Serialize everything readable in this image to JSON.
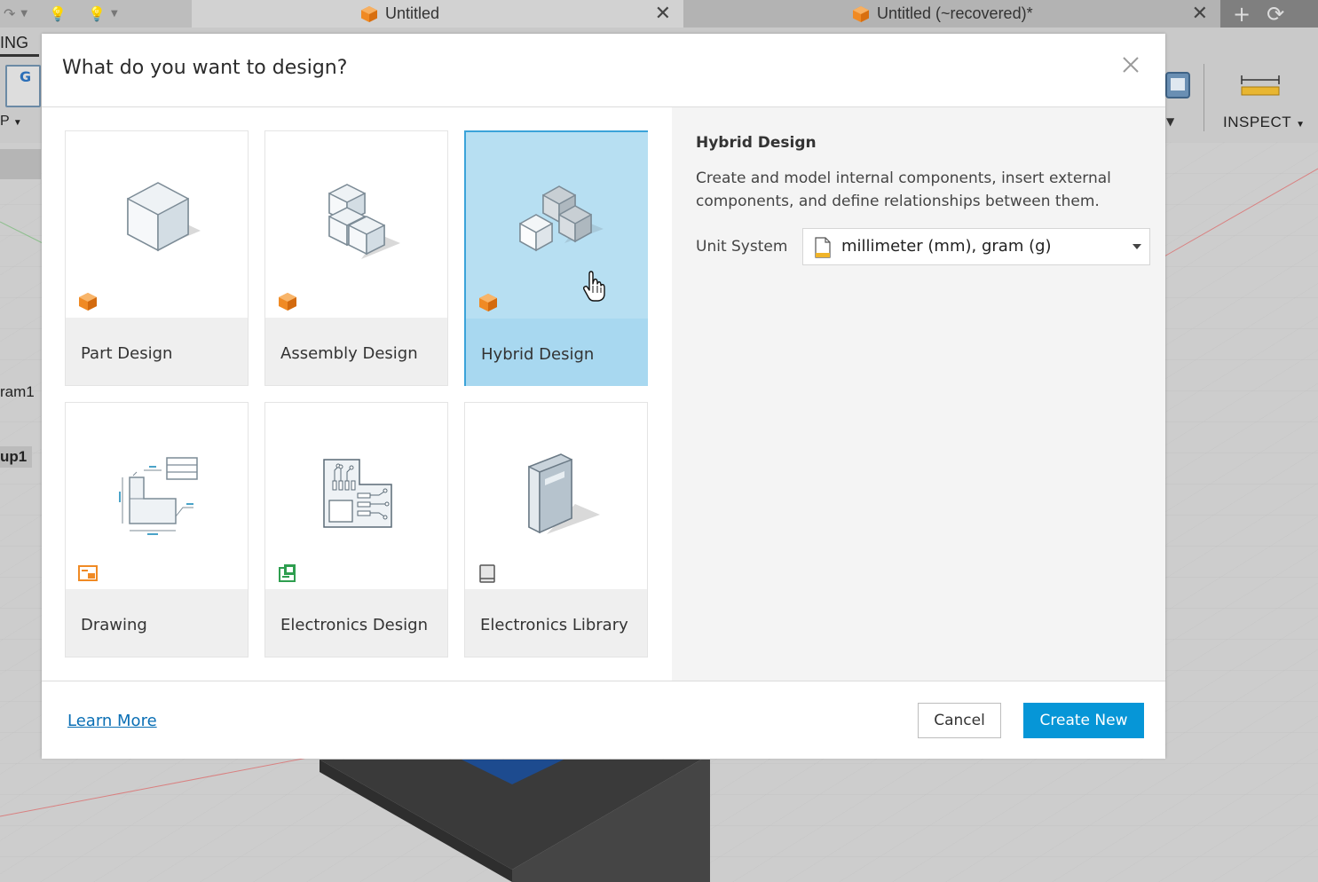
{
  "app": {
    "tabs": [
      {
        "label": "Untitled"
      },
      {
        "label": "Untitled (~recovered)*"
      }
    ],
    "workspace_label": "ING",
    "toolbar_left_label": "P",
    "toolbar_right_label": "INSPECT",
    "browser_items": [
      "ram1",
      "up1"
    ]
  },
  "dialog": {
    "title": "What do you want to design?",
    "cards": [
      {
        "label": "Part Design",
        "selected": false
      },
      {
        "label": "Assembly Design",
        "selected": false
      },
      {
        "label": "Hybrid Design",
        "selected": true
      },
      {
        "label": "Drawing",
        "selected": false
      },
      {
        "label": "Electronics Design",
        "selected": false
      },
      {
        "label": "Electronics Library",
        "selected": false
      }
    ],
    "info": {
      "title": "Hybrid Design",
      "description": "Create and model internal components, insert external components, and define relationships between them.",
      "unit_label": "Unit System",
      "unit_value": "millimeter (mm), gram (g)"
    },
    "footer": {
      "learn_more": "Learn More",
      "cancel": "Cancel",
      "create": "Create New"
    }
  },
  "colors": {
    "accent": "#0696d7",
    "selected_card": "#b7dff2",
    "selected_border": "#3ba3d9",
    "badge_orange": "#f08a24"
  }
}
